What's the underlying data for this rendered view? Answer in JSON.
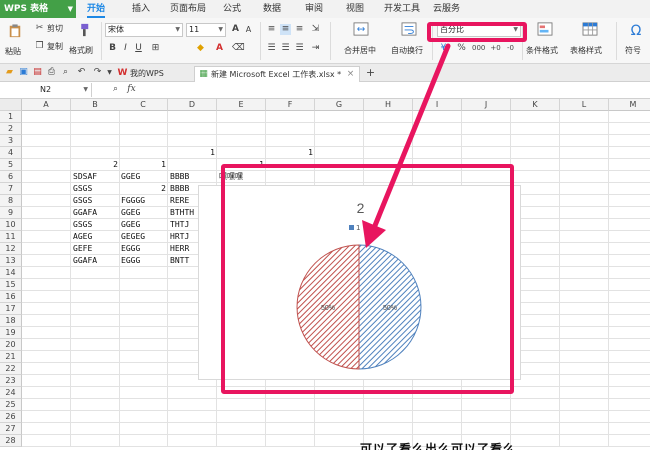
{
  "menubar": {
    "brand": "WPS 表格",
    "items": [
      "开始",
      "插入",
      "页面布局",
      "公式",
      "数据",
      "审阅",
      "视图",
      "开发工具",
      "云服务"
    ]
  },
  "ribbon": {
    "paste": "粘贴",
    "cut": "剪切",
    "copy": "复制",
    "format_painter": "格式刷",
    "font_name": "宋体",
    "font_size": "11",
    "merge_center": "合并居中",
    "wrap_text": "自动换行",
    "number_format": "百分比",
    "conditional_format": "条件格式",
    "table_style": "表格样式",
    "symbol": "符号"
  },
  "doctabs": {
    "tabs": [
      "我的WPS",
      "新建 Microsoft Excel 工作表.xlsx *"
    ]
  },
  "formula_bar": {
    "name_box": "N2",
    "fx": "fx"
  },
  "grid": {
    "columns": [
      "A",
      "B",
      "C",
      "D",
      "E",
      "F",
      "G",
      "H",
      "I",
      "J",
      "K",
      "L",
      "M"
    ],
    "rows": [
      "1",
      "2",
      "3",
      "4",
      "5",
      "6",
      "7",
      "8",
      "9",
      "10",
      "11",
      "12",
      "13",
      "14",
      "15",
      "16",
      "17",
      "18",
      "19",
      "20",
      "21",
      "22",
      "23",
      "24",
      "25",
      "26",
      "27",
      "28"
    ],
    "cells": {
      "D4": "1",
      "F4": "1",
      "B5": "2",
      "C5": "1",
      "E5": "1",
      "B6": "SDSAF",
      "C6": "GGEG",
      "D6": "BBBB",
      "E6": "嘿嘿嘿",
      "B7": "GSGS",
      "C7": "2",
      "D7": "BBBB",
      "B8": "GSGS",
      "C8": "FGGGG",
      "D8": "RERE",
      "B9": "GGAFA",
      "C9": "GGEG",
      "D9": "BTHTH",
      "B10": "GSGS",
      "C10": "GGEG",
      "D10": "THTJ",
      "B11": "AGEG",
      "C11": "GEGEG",
      "D11": "HRTJ",
      "B12": "GEFE",
      "C12": "EGGG",
      "D12": "HERR",
      "B13": "GGAFA",
      "C13": "EGGG",
      "D13": "BNTT"
    }
  },
  "chart_data": {
    "type": "pie",
    "title": "2",
    "legend": [
      "1"
    ],
    "legend_position": "top",
    "slices": [
      {
        "label": "50%",
        "value": 50,
        "color": "#4f81bd",
        "pattern": "diagonal-hatch"
      },
      {
        "label": "50%",
        "value": 50,
        "color": "#c0504d",
        "pattern": "diagonal-hatch"
      }
    ]
  },
  "annotation": {
    "highlight_color": "#e8155f",
    "bottom_text": "可以了看么出么可以了看么"
  }
}
